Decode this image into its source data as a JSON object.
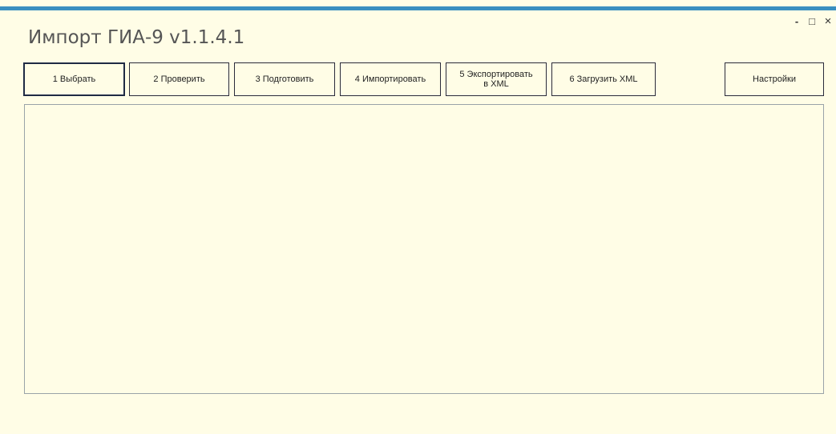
{
  "window": {
    "title": "Импорт ГИА-9 v1.1.4.1",
    "controls": {
      "minimize": "-",
      "maximize": "□",
      "close": "×"
    }
  },
  "toolbar": {
    "buttons": [
      {
        "label": "1   Выбрать"
      },
      {
        "label": "2   Проверить"
      },
      {
        "label": "3  Подготовить"
      },
      {
        "label": "4 Импортировать"
      },
      {
        "label": "5 Экспортировать\nв XML"
      },
      {
        "label": "6 Загрузить XML"
      },
      {
        "label": "Настройки"
      }
    ]
  },
  "colors": {
    "background": "#fffde6",
    "accent": "#3a8fc0",
    "border": "#2a2a3a"
  }
}
